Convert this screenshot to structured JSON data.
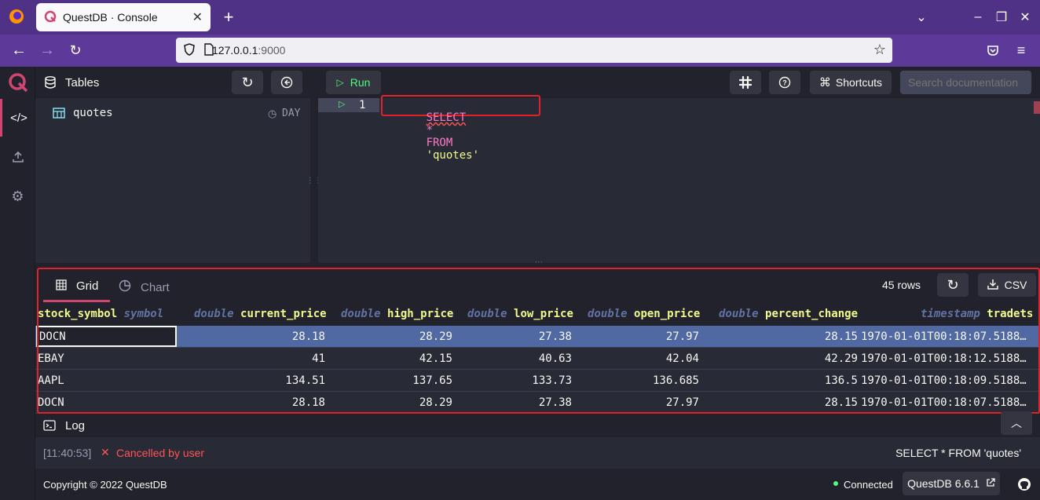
{
  "browser": {
    "tab_title": "QuestDB · Console",
    "url_host": "127.0.0.1",
    "url_port": ":9000"
  },
  "schema": {
    "title": "Tables",
    "tables": [
      {
        "name": "quotes",
        "partition": "DAY"
      }
    ]
  },
  "toolbar": {
    "run_label": "Run",
    "shortcuts_label": "Shortcuts",
    "search_placeholder": "Search documentation"
  },
  "editor": {
    "line_number": "1",
    "query_keyword_select": "SELECT",
    "query_star": "*",
    "query_keyword_from": "FROM",
    "query_string": "'quotes'"
  },
  "results": {
    "tabs": [
      {
        "label": "Grid",
        "active": true
      },
      {
        "label": "Chart",
        "active": false
      }
    ],
    "row_count": "45 rows",
    "csv_label": "CSV",
    "columns": [
      {
        "name": "stock_symbol",
        "type": "symbol"
      },
      {
        "name": "current_price",
        "type": "double"
      },
      {
        "name": "high_price",
        "type": "double"
      },
      {
        "name": "low_price",
        "type": "double"
      },
      {
        "name": "open_price",
        "type": "double"
      },
      {
        "name": "percent_change",
        "type": "double"
      },
      {
        "name": "tradets",
        "type": "timestamp"
      }
    ],
    "rows": [
      [
        "DOCN",
        "28.18",
        "28.29",
        "27.38",
        "27.97",
        "28.15",
        "1970-01-01T00:18:07.5188…"
      ],
      [
        "EBAY",
        "41",
        "42.15",
        "40.63",
        "42.04",
        "42.29",
        "1970-01-01T00:18:12.5188…"
      ],
      [
        "AAPL",
        "134.51",
        "137.65",
        "133.73",
        "136.685",
        "136.5",
        "1970-01-01T00:18:09.5188…"
      ],
      [
        "DOCN",
        "28.18",
        "28.29",
        "27.38",
        "27.97",
        "28.15",
        "1970-01-01T00:18:07.5188…"
      ]
    ]
  },
  "log": {
    "title": "Log",
    "time": "[11:40:53]",
    "message": "Cancelled by user",
    "query": "SELECT * FROM 'quotes'"
  },
  "footer": {
    "copyright": "Copyright © 2022 QuestDB",
    "status": "Connected",
    "version": "QuestDB 6.6.1"
  },
  "colors": {
    "accent": "#d14671",
    "run_green": "#50fa7b",
    "error_red": "#ff5555",
    "selection": "#5169a3"
  }
}
